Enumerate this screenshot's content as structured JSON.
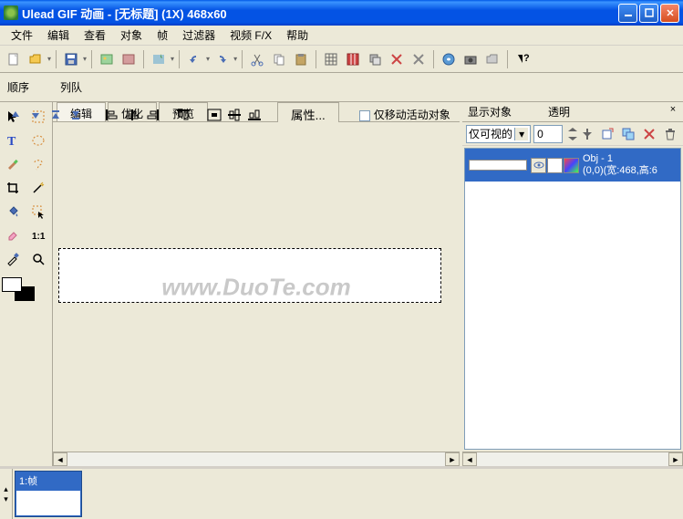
{
  "title": "Ulead GIF 动画 - [无标题] (1X) 468x60",
  "menu": [
    "文件",
    "编辑",
    "查看",
    "对象",
    "帧",
    "过滤器",
    "视频 F/X",
    "帮助"
  ],
  "toolbar2": {
    "seq": "顺序",
    "queue": "列队",
    "props": "属性...",
    "moveonly": "仅移动活动对象"
  },
  "tabs": [
    "编辑",
    "优化",
    "预览"
  ],
  "rpanel": {
    "show": "显示对象",
    "trans": "透明",
    "dropdown": "仅可视的",
    "spin": "0",
    "obj_name": "Obj - 1",
    "obj_info": "(0,0)(宽:468,高:6"
  },
  "timeline": {
    "frame": "1:帧"
  },
  "watermark": "www.DuoTe.com"
}
